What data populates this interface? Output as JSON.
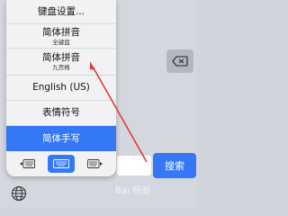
{
  "menu": {
    "items": [
      {
        "label": "键盘设置...",
        "sub": ""
      },
      {
        "label": "简体拼音",
        "sub": "全键盘"
      },
      {
        "label": "简体拼音",
        "sub": "九宫格"
      },
      {
        "label": "English (US)",
        "sub": ""
      },
      {
        "label": "表情符号",
        "sub": ""
      },
      {
        "label": "简体手写",
        "sub": ""
      }
    ],
    "selected_index": 5
  },
  "keyboard": {
    "search_label": "搜索"
  },
  "watermark": "Bai 经验",
  "colors": {
    "accent": "#3478f6",
    "annotation_arrow": "#e53935"
  },
  "icons": {
    "globe": "globe-icon",
    "delete": "delete-icon",
    "keyboard_left": "keyboard-left-icon",
    "keyboard_full": "keyboard-full-icon",
    "keyboard_right": "keyboard-right-icon"
  }
}
